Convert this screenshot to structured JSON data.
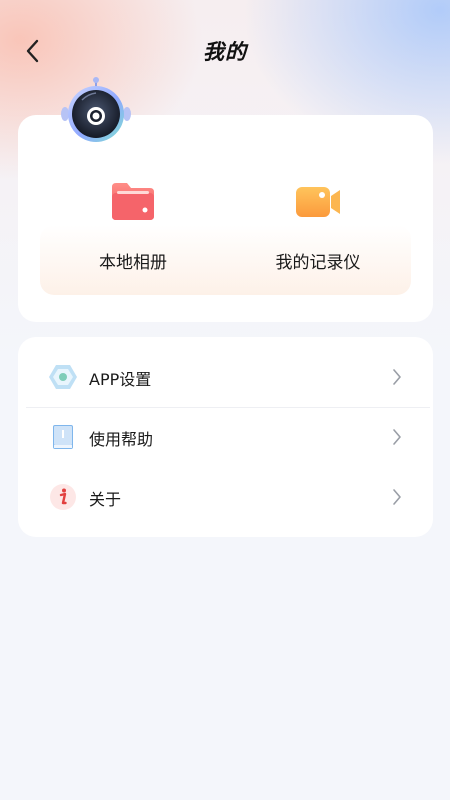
{
  "header": {
    "title": "我的",
    "back_icon": "chevron-left-icon"
  },
  "features": [
    {
      "label": "本地相册",
      "icon": "folder-icon",
      "color": "#f46a6e"
    },
    {
      "label": "我的记录仪",
      "icon": "video-camera-icon",
      "color": "#fba64a"
    }
  ],
  "menu": [
    {
      "label": "APP设置",
      "icon": "settings-hexagon-icon"
    },
    {
      "label": "使用帮助",
      "icon": "help-book-icon"
    },
    {
      "label": "关于",
      "icon": "info-icon"
    }
  ],
  "colors": {
    "background": "#f4f6fb",
    "card": "#ffffff",
    "accent_red": "#e2403f",
    "accent_blue": "#6fa8f0"
  }
}
